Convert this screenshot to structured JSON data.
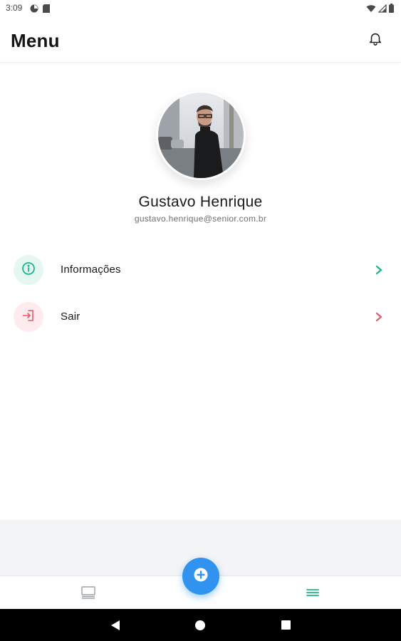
{
  "status_bar": {
    "time": "3:09",
    "left_icons": [
      "data-saver-icon",
      "sd-card-icon"
    ],
    "right_icons": [
      "wifi-icon",
      "cell-signal-icon",
      "battery-icon"
    ]
  },
  "app_bar": {
    "title": "Menu",
    "notification_icon": "bell-icon"
  },
  "profile": {
    "avatar_alt": "profile-photo",
    "name": "Gustavo Henrique",
    "email": "gustavo.henrique@senior.com.br"
  },
  "menu": {
    "items": [
      {
        "label": "Informações",
        "icon": "info-icon",
        "accent": "#15b88a",
        "icon_bg": "#e5f7f1"
      },
      {
        "label": "Sair",
        "icon": "logout-icon",
        "accent": "#e45a6a",
        "icon_bg": "#fdebed"
      }
    ]
  },
  "bottom_nav": {
    "items": [
      {
        "icon": "dashboard-icon",
        "active": false
      },
      {
        "icon": "hamburger-menu-icon",
        "active": true
      }
    ],
    "fab_icon": "plus-circle-icon",
    "active_color": "#1cb98a",
    "fab_color": "#2f93ef"
  },
  "system_nav": {
    "buttons": [
      "back-icon",
      "home-icon",
      "recents-icon"
    ]
  }
}
